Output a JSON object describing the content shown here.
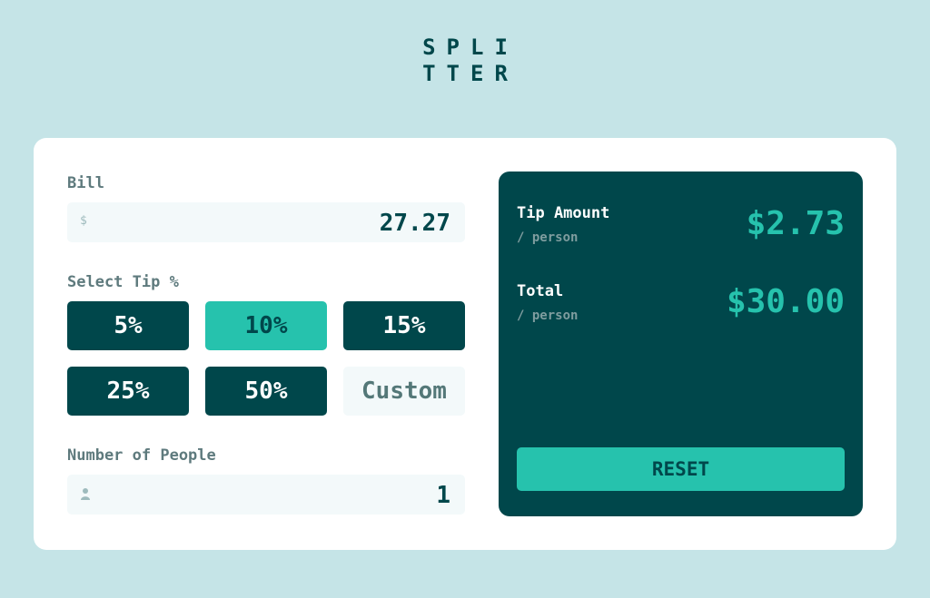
{
  "logo": {
    "line1": "SPLI",
    "line2": "TTER"
  },
  "bill": {
    "label": "Bill",
    "currency_icon": "$",
    "value": "27.27"
  },
  "tip": {
    "label": "Select Tip %",
    "options": [
      "5%",
      "10%",
      "15%",
      "25%",
      "50%"
    ],
    "selected": "10%",
    "custom_placeholder": "Custom"
  },
  "people": {
    "label": "Number of People",
    "value": "1",
    "icon": "person-icon"
  },
  "results": {
    "tip_label": "Tip Amount",
    "tip_sub": "/ person",
    "tip_value": "$2.73",
    "total_label": "Total",
    "total_sub": "/ person",
    "total_value": "$30.00",
    "reset_label": "RESET"
  },
  "colors": {
    "background": "#c5e4e7",
    "dark_cyan": "#00474b",
    "strong_cyan": "#26c2ad",
    "input_bg": "#f3f9fa"
  }
}
